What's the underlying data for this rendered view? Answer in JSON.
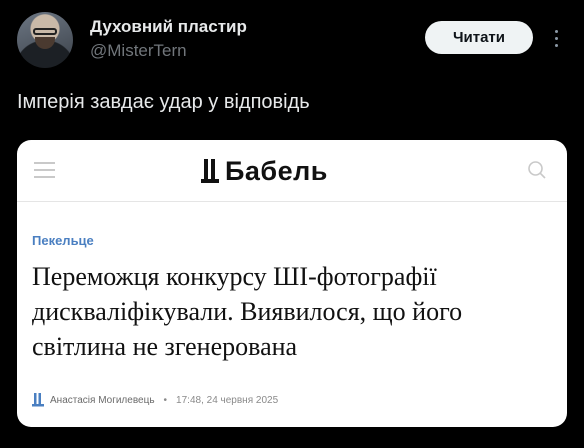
{
  "tweet": {
    "author": {
      "display_name": "Духовний пластир",
      "handle": "@MisterTern"
    },
    "follow_label": "Читати",
    "text": "Імперія завдає удар у відповідь"
  },
  "card": {
    "site_logo_text": "Бабель",
    "category": "Пекельце",
    "headline": "Переможця конкурсу ШІ-фотографії дискваліфікували. Виявилося, що його світлина не згенерована",
    "author": "Анастасія Могилевець",
    "separator": "•",
    "timestamp": "17:48, 24 червня 2025"
  },
  "colors": {
    "background": "#000000",
    "category": "#4a7fc1",
    "follow_button": "#eff3f4"
  }
}
